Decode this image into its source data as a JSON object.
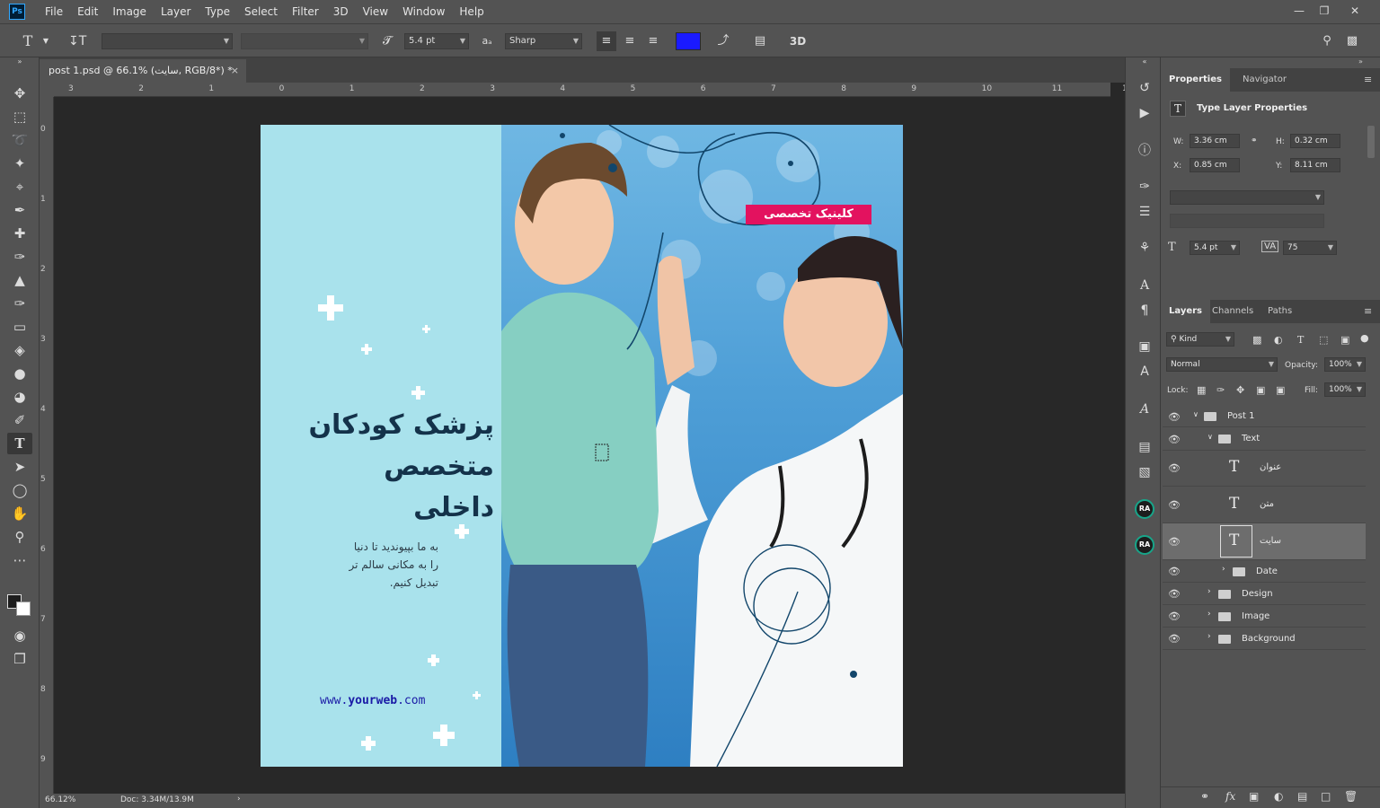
{
  "menu": {
    "app_logo": "Ps",
    "items": [
      "File",
      "Edit",
      "Image",
      "Layer",
      "Type",
      "Select",
      "Filter",
      "3D",
      "View",
      "Window",
      "Help"
    ]
  },
  "options_bar": {
    "font_size": "5.4 pt",
    "antialias": "Sharp",
    "text_color": "#1a1aff",
    "threeD": "3D"
  },
  "document": {
    "tab_title": "post 1.psd @ 66.1% (سایت, RGB/8*) *",
    "headline_lines": [
      "پزشک کودکان",
      "متخصص",
      "داخلی"
    ],
    "body_lines": [
      "به ما بپیوندید تا دنیا",
      "را به مکانی سالم تر",
      "تبدیل کنیم."
    ],
    "website_prefix": "www.",
    "website_bold": "yourweb",
    "website_suffix": ".com",
    "badge": "کلینیک تخصصی",
    "colors": {
      "panel": "#a9e2ec",
      "headline": "#14324a",
      "badge": "#e3125f",
      "link": "#1a1aa6"
    }
  },
  "rulers": {
    "horizontal": [
      "3",
      "2",
      "1",
      "0",
      "1",
      "2",
      "3",
      "4",
      "5",
      "6",
      "7",
      "8",
      "9",
      "10",
      "11",
      "1"
    ],
    "vertical": [
      "0",
      "1",
      "2",
      "3",
      "4",
      "5",
      "6",
      "7",
      "8",
      "9"
    ]
  },
  "status": {
    "zoom": "66.12%",
    "doc": "Doc: 3.34M/13.9M"
  },
  "properties": {
    "tabs": [
      "Properties",
      "Navigator"
    ],
    "section_title": "Type Layer Properties",
    "w_label": "W:",
    "w": "3.36 cm",
    "h_label": "H:",
    "h": "0.32 cm",
    "x_label": "X:",
    "x": "0.85 cm",
    "y_label": "Y:",
    "y": "8.11 cm",
    "size": "5.4 pt",
    "tracking": "75"
  },
  "layers": {
    "tabs": [
      "Layers",
      "Channels",
      "Paths"
    ],
    "filter": "Kind",
    "blend": "Normal",
    "opacity_label": "Opacity:",
    "opacity": "100%",
    "lock_label": "Lock:",
    "fill_label": "Fill:",
    "fill": "100%",
    "items": [
      {
        "name": "Post 1",
        "type": "group"
      },
      {
        "name": "Text",
        "type": "group"
      },
      {
        "name": "عنوان",
        "type": "text"
      },
      {
        "name": "متن",
        "type": "text"
      },
      {
        "name": "سایت",
        "type": "text"
      },
      {
        "name": "Date",
        "type": "group"
      },
      {
        "name": "Design",
        "type": "group"
      },
      {
        "name": "Image",
        "type": "group"
      },
      {
        "name": "Background",
        "type": "group"
      }
    ]
  }
}
